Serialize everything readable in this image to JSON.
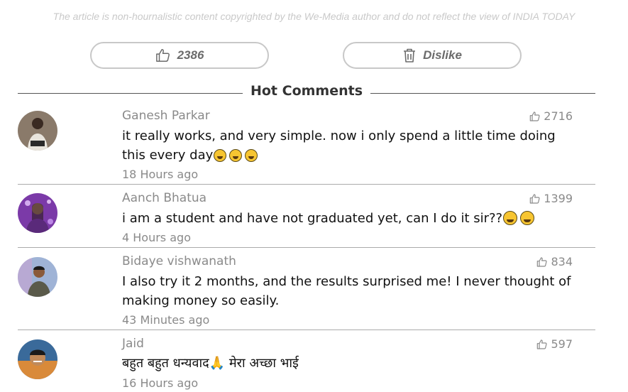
{
  "disclaimer": "The article is non-hournalistic content copyrighted by the We-Media author and do not reflect the view of INDIA TODAY",
  "votes": {
    "like_count": "2386",
    "dislike_label": "Dislike"
  },
  "section_title": "Hot Comments",
  "icons": {
    "like": "thumbs-up-icon",
    "dislike": "trash-icon"
  },
  "comments": [
    {
      "name": "Ganesh Parkar",
      "likes": "2716",
      "text": "it really works, and very simple. now i only spend a little time doing this every day",
      "time": "18 Hours ago",
      "avatar_color": "#6b4a3a"
    },
    {
      "name": "Aanch Bhatua",
      "likes": "1399",
      "text": "i am a student and have not graduated yet, can I do it sir??",
      "time": "4 Hours ago",
      "avatar_color": "#7b3aa8"
    },
    {
      "name": "Bidaye vishwanath",
      "likes": "834",
      "text": "I also try it 2 months, and the results surprised me! I never thought of making money so easily.",
      "time": "43 Minutes ago",
      "avatar_color": "#6a7fa0"
    },
    {
      "name": "Jaid",
      "likes": "597",
      "text": "बहुत बहुत धन्यवाद🙏 मेरा अच्छा भाई",
      "time": "16 Hours ago",
      "avatar_color": "#d98a3a"
    }
  ]
}
